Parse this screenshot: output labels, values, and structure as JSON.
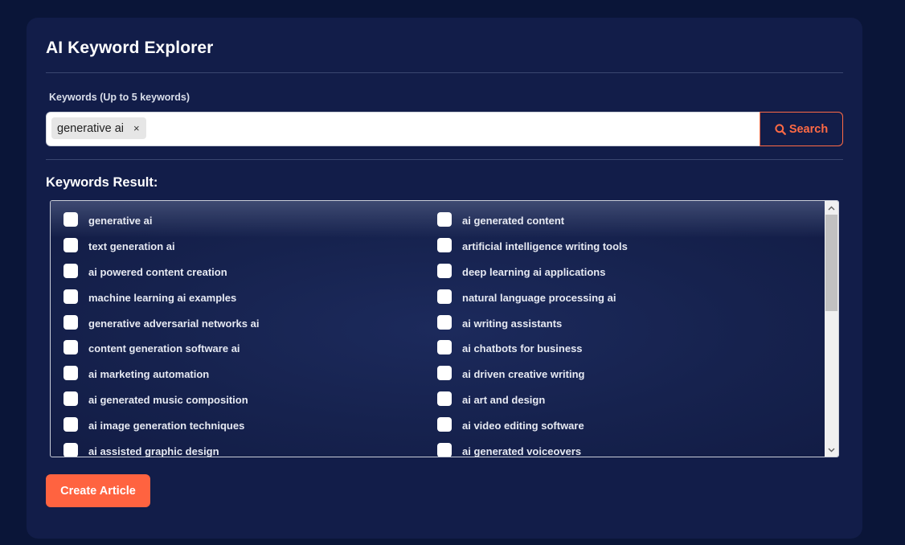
{
  "app": {
    "title": "AI Keyword Explorer"
  },
  "search": {
    "label": "Keywords (Up to 5 keywords)",
    "tags": [
      {
        "text": "generative ai",
        "remove_symbol": "×"
      }
    ],
    "button_label": "Search",
    "button_icon": "search-icon"
  },
  "results": {
    "label": "Keywords Result:",
    "left_column": [
      "generative ai",
      "text generation ai",
      "ai powered content creation",
      "machine learning ai examples",
      "generative adversarial networks ai",
      "content generation software ai",
      "ai marketing automation",
      "ai generated music composition",
      "ai image generation techniques",
      "ai assisted graphic design"
    ],
    "right_column": [
      "ai generated content",
      "artificial intelligence writing tools",
      "deep learning ai applications",
      "natural language processing ai",
      "ai writing assistants",
      "ai chatbots for business",
      "ai driven creative writing",
      "ai art and design",
      "ai video editing software",
      "ai generated voiceovers"
    ]
  },
  "actions": {
    "create_label": "Create Article"
  },
  "colors": {
    "page_bg": "#0a1538",
    "card_bg": "#121d49",
    "accent": "#ff6340"
  }
}
